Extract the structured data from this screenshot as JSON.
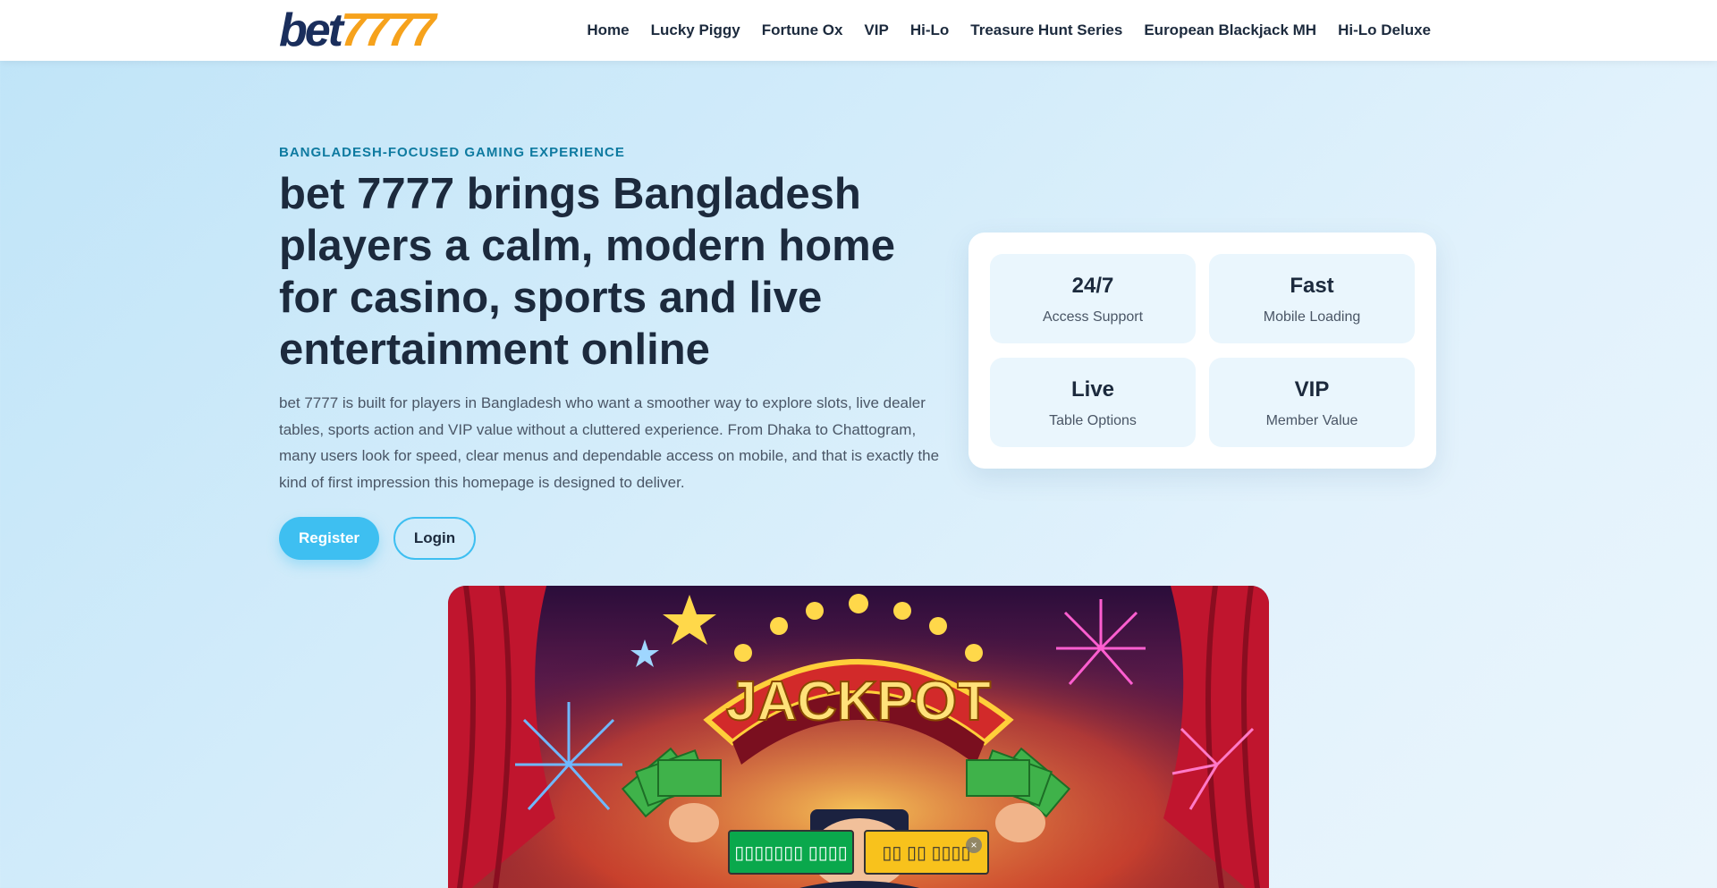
{
  "logo": {
    "part1": "bet",
    "part2": "7777"
  },
  "nav": {
    "items": [
      {
        "label": "Home"
      },
      {
        "label": "Lucky Piggy"
      },
      {
        "label": "Fortune Ox"
      },
      {
        "label": "VIP"
      },
      {
        "label": "Hi-Lo"
      },
      {
        "label": "Treasure Hunt Series"
      },
      {
        "label": "European Blackjack MH"
      },
      {
        "label": "Hi-Lo Deluxe"
      }
    ]
  },
  "hero": {
    "eyebrow": "BANGLADESH-FOCUSED GAMING EXPERIENCE",
    "title": "bet 7777 brings Bangladesh players a calm, modern home for casino, sports and live entertainment online",
    "text": "bet 7777 is built for players in Bangladesh who want a smoother way to explore slots, live dealer tables, sports action and VIP value without a cluttered experience. From Dhaka to Chattogram, many users look for speed, clear menus and dependable access on mobile, and that is exactly the kind of first impression this homepage is designed to deliver.",
    "register_label": "Register",
    "login_label": "Login"
  },
  "stats": [
    {
      "value": "24/7",
      "label": "Access Support"
    },
    {
      "value": "Fast",
      "label": "Mobile Loading"
    },
    {
      "value": "Live",
      "label": "Table Options"
    },
    {
      "value": "VIP",
      "label": "Member Value"
    }
  ],
  "banner": {
    "text": "JACKPOT"
  },
  "popup": {
    "green_label": "▯▯▯▯▯▯▯ ▯▯▯▯",
    "yellow_label": "▯▯ ▯▯ ▯▯▯▯",
    "close_label": "×"
  },
  "colors": {
    "accent": "#3ebff1",
    "brand_navy": "#1a2e5c",
    "brand_orange": "#f6a21c",
    "eyebrow": "#0e7aa0"
  }
}
